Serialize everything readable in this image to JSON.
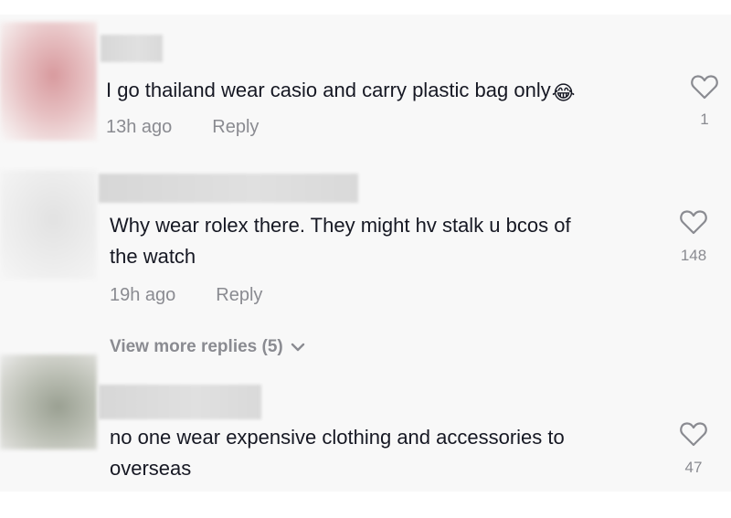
{
  "comments": [
    {
      "text": "I go thailand wear casio and carry plastic bag only",
      "emoji": "😂",
      "time": "13h ago",
      "reply_label": "Reply",
      "likes": "1",
      "icon": "heart-outline-icon"
    },
    {
      "text_line1": "Why wear rolex there. They might hv stalk u bcos of",
      "text_line2": "the watch",
      "time": "19h ago",
      "reply_label": "Reply",
      "likes": "148",
      "view_more": "View more replies (5)",
      "icon": "heart-outline-icon"
    },
    {
      "text_line1": "no one wear expensive clothing and accessories to",
      "text_line2": "overseas",
      "likes": "47",
      "icon": "heart-outline-icon"
    }
  ],
  "colors": {
    "background": "#f8f8f8",
    "text": "#161823",
    "muted": "#8a8b91"
  }
}
